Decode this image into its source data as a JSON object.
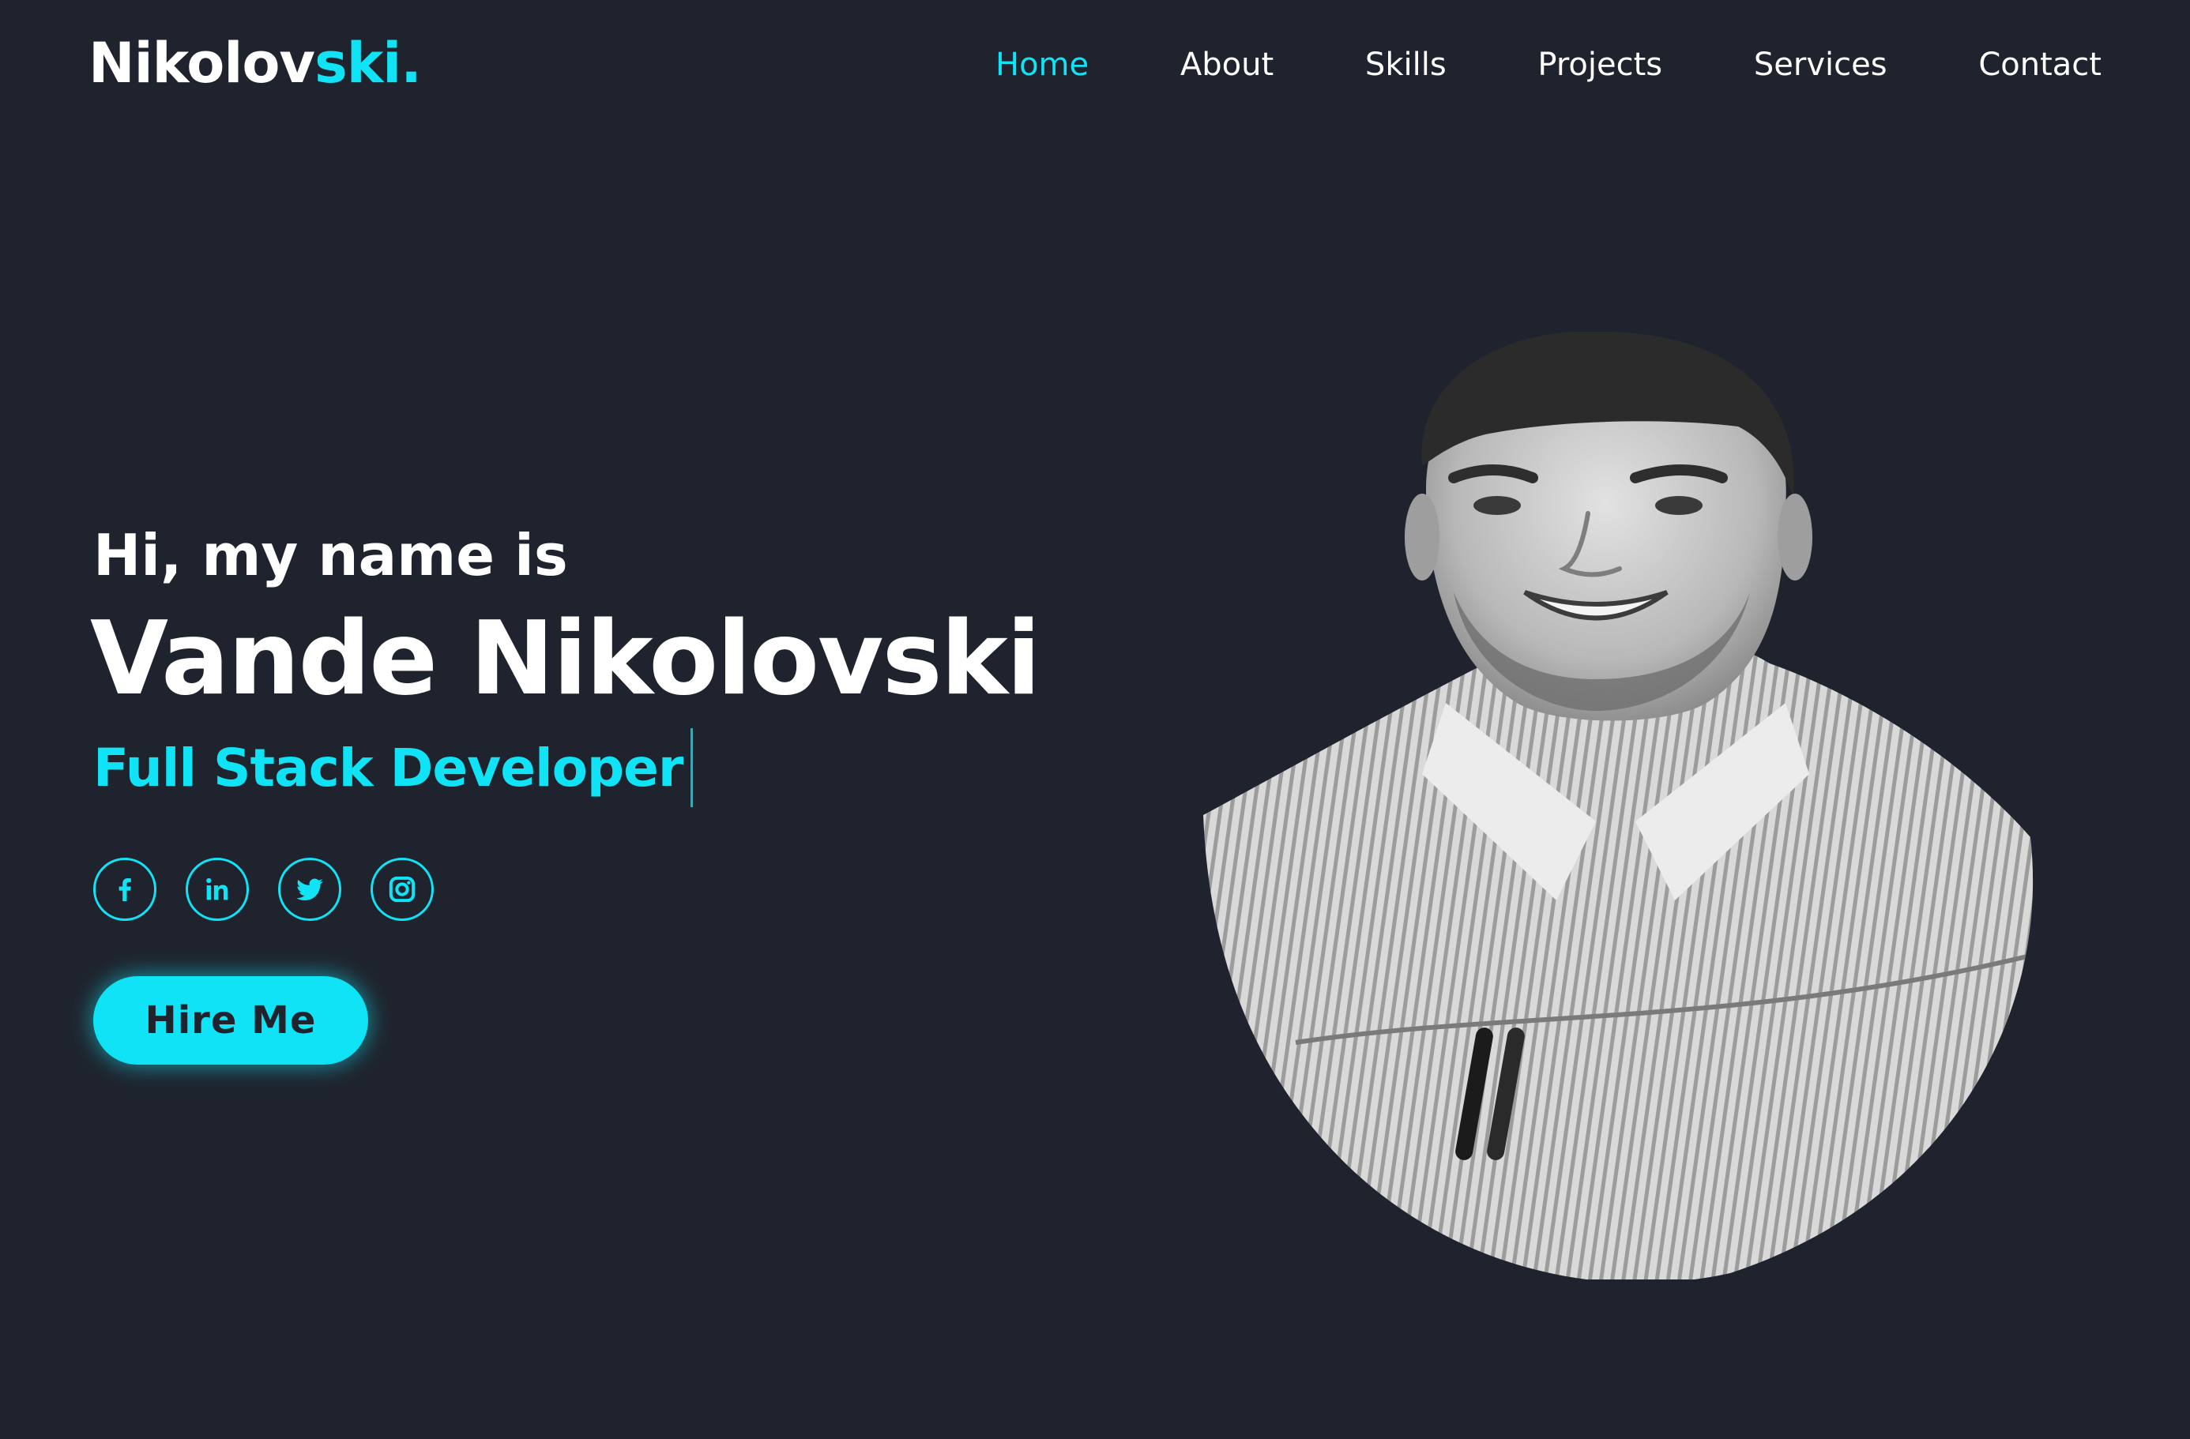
{
  "brand": {
    "logo_main": "Nikolov",
    "logo_accent": "ski."
  },
  "nav": {
    "items": [
      {
        "label": "Home",
        "active": true
      },
      {
        "label": "About",
        "active": false
      },
      {
        "label": "Skills",
        "active": false
      },
      {
        "label": "Projects",
        "active": false
      },
      {
        "label": "Services",
        "active": false
      },
      {
        "label": "Contact",
        "active": false
      }
    ]
  },
  "hero": {
    "greeting": "Hi, my name is",
    "name": "Vande Nikolovski",
    "role": "Full Stack Developer",
    "button_label": "Hire Me",
    "socials": [
      "facebook-icon",
      "linkedin-icon",
      "twitter-icon",
      "instagram-icon"
    ]
  },
  "colors": {
    "background": "#1f232d",
    "accent": "#0fe3f5",
    "text": "#ffffff"
  }
}
